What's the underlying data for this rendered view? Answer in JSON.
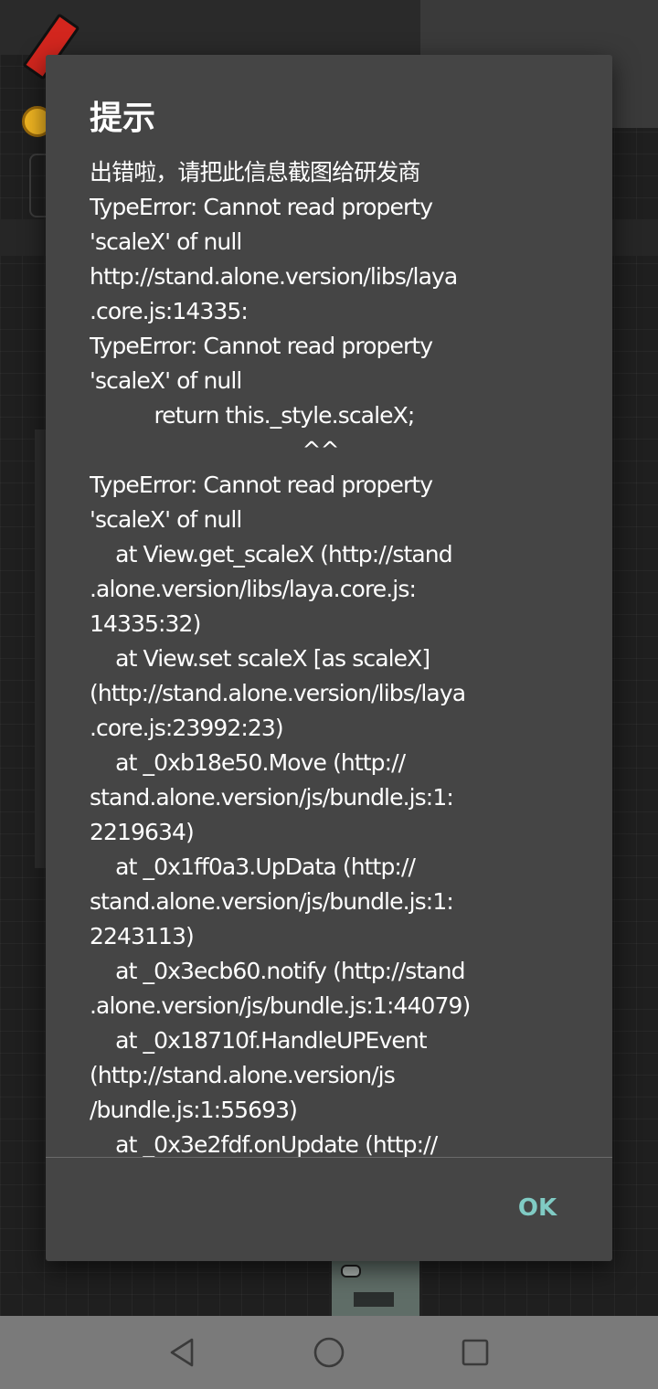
{
  "dialog": {
    "title": "提示",
    "message": "出错啦，请把此信息截图给研发商\nTypeError: Cannot read property\n'scaleX' of null\nhttp://stand.alone.version/libs/laya\n.core.js:14335:\nTypeError: Cannot read property\n'scaleX' of null\n          return this._style.scaleX;\n                                 ^^\nTypeError: Cannot read property\n'scaleX' of null\n    at View.get_scaleX (http://stand\n.alone.version/libs/laya.core.js:\n14335:32)\n    at View.set scaleX [as scaleX]\n(http://stand.alone.version/libs/laya\n.core.js:23992:23)\n    at _0xb18e50.Move (http://\nstand.alone.version/js/bundle.js:1:\n2219634)\n    at _0x1ff0a3.UpData (http://\nstand.alone.version/js/bundle.js:1:\n2243113)\n    at _0x3ecb60.notify (http://stand\n.alone.version/js/bundle.js:1:44079)\n    at _0x18710f.HandleUPEvent\n(http://stand.alone.version/js\n/bundle.js:1:55693)\n    at _0x3e2fdf.onUpdate (http://",
    "ok_label": "OK"
  },
  "nav_bar": {
    "icons": [
      "back-triangle-icon",
      "home-circle-icon",
      "recents-square-icon"
    ]
  },
  "colors": {
    "dialog_background": "#454545",
    "accent": "#80cbc4",
    "nav_bar": "#7a7a7a"
  }
}
